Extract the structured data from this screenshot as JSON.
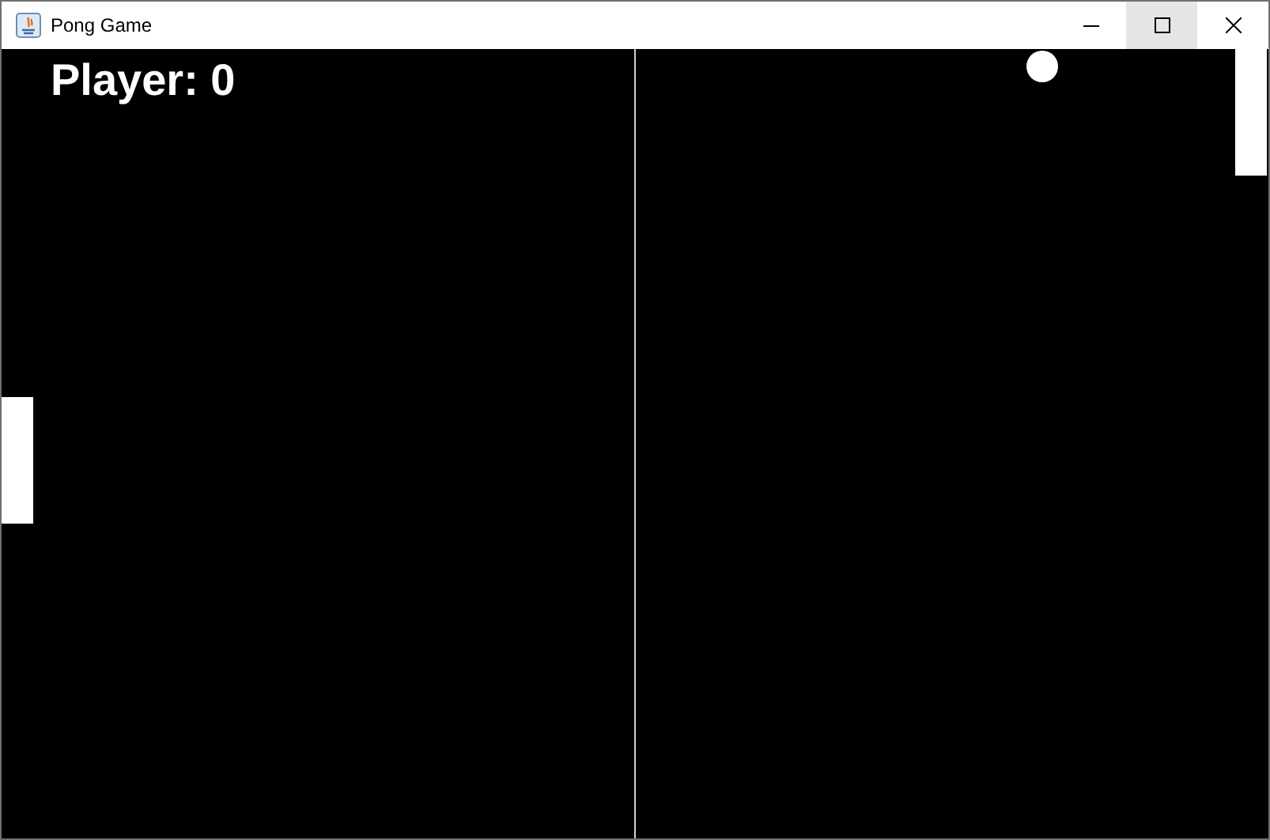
{
  "window": {
    "title": "Pong Game"
  },
  "title_buttons": [
    {
      "kind": "minimize",
      "hovered": false
    },
    {
      "kind": "maximize",
      "hovered": true
    },
    {
      "kind": "close",
      "hovered": false
    }
  ],
  "game": {
    "score": "Player: 0"
  }
}
